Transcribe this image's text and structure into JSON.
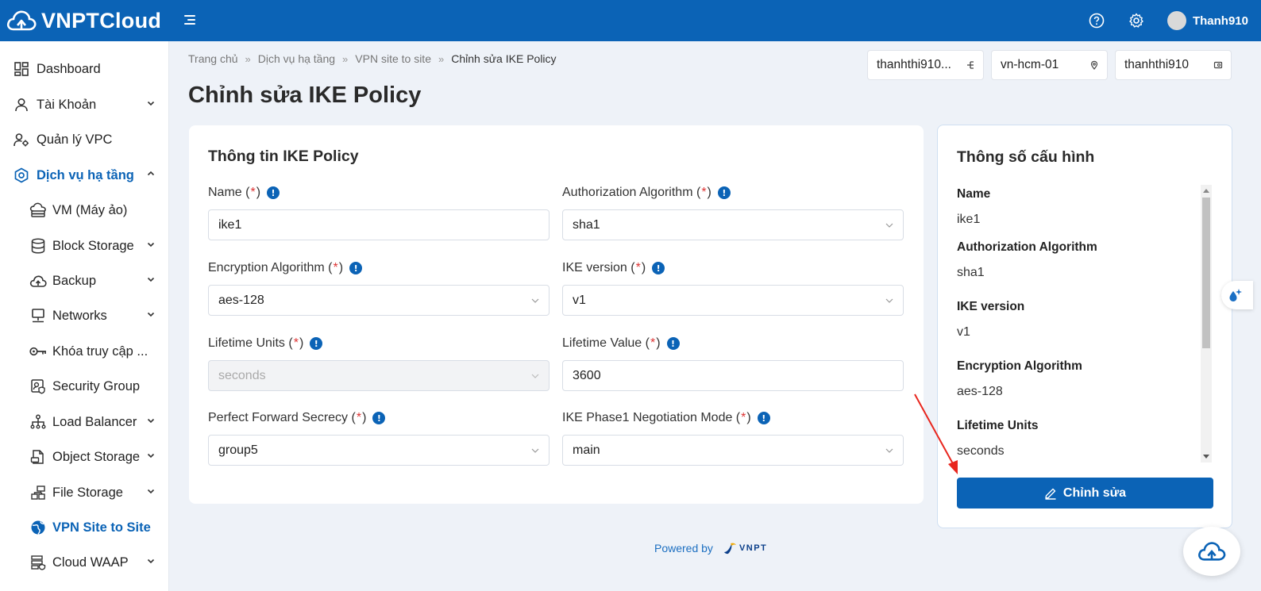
{
  "app": {
    "name": "VNPTCloud",
    "user": "Thanh910"
  },
  "colors": {
    "brand": "#0b63b6",
    "required": "#dd3333",
    "annotation_arrow": "#e8261e"
  },
  "sidebar": {
    "items": [
      {
        "label": "Dashboard",
        "icon": "dashboard-icon",
        "expandable": false
      },
      {
        "label": "Tài Khoản",
        "icon": "user-icon",
        "expandable": true
      },
      {
        "label": "Quản lý VPC",
        "icon": "vpc-manage-icon",
        "expandable": false
      },
      {
        "label": "Dịch vụ hạ tầng",
        "icon": "infrastructure-icon",
        "expandable": true,
        "expanded": true
      },
      {
        "label": "VM (Máy ảo)",
        "icon": "cloud-vm-icon",
        "expandable": false
      },
      {
        "label": "Block Storage",
        "icon": "database-icon",
        "expandable": true
      },
      {
        "label": "Backup",
        "icon": "cloud-upload-icon",
        "expandable": true
      },
      {
        "label": "Networks",
        "icon": "network-icon",
        "expandable": true
      },
      {
        "label": "Khóa truy cập ...",
        "icon": "key-icon",
        "expandable": false
      },
      {
        "label": "Security Group",
        "icon": "security-group-icon",
        "expandable": false
      },
      {
        "label": "Load Balancer",
        "icon": "load-balancer-icon",
        "expandable": true
      },
      {
        "label": "Object Storage",
        "icon": "object-storage-icon",
        "expandable": true
      },
      {
        "label": "File Storage",
        "icon": "file-storage-icon",
        "expandable": true
      },
      {
        "label": "VPN Site to Site",
        "icon": "globe-icon",
        "expandable": false,
        "active": true
      },
      {
        "label": "Cloud WAAP",
        "icon": "waap-icon",
        "expandable": true
      }
    ]
  },
  "breadcrumb": [
    "Trang chủ",
    "Dịch vụ hạ tầng",
    "VPN site to site",
    "Chỉnh sửa IKE Policy"
  ],
  "page": {
    "title": "Chỉnh sửa IKE Policy"
  },
  "selectors": {
    "project": "thanhthi910...",
    "region": "vn-hcm-01",
    "account": "thanhthi910"
  },
  "form": {
    "title": "Thông tin IKE Policy",
    "fields": [
      {
        "label": "Name",
        "value": "ike1",
        "type": "text"
      },
      {
        "label": "Authorization Algorithm",
        "value": "sha1",
        "type": "select"
      },
      {
        "label": "Encryption Algorithm",
        "value": "aes-128",
        "type": "select"
      },
      {
        "label": "IKE version",
        "value": "v1",
        "type": "select"
      },
      {
        "label": "Lifetime Units",
        "value": "seconds",
        "type": "select",
        "disabled": true
      },
      {
        "label": "Lifetime Value",
        "value": "3600",
        "type": "text"
      },
      {
        "label": "Perfect Forward Secrecy",
        "value": "group5",
        "type": "select"
      },
      {
        "label": "IKE Phase1 Negotiation Mode",
        "value": "main",
        "type": "select"
      }
    ],
    "required_mark": "*"
  },
  "side_panel": {
    "title": "Thông số cấu hình",
    "specs": [
      {
        "label": "Name",
        "value": "ike1"
      },
      {
        "label": "Authorization Algorithm",
        "value": "sha1"
      },
      {
        "label": "IKE version",
        "value": "v1"
      },
      {
        "label": "Encryption Algorithm",
        "value": "aes-128"
      },
      {
        "label": "Lifetime Units",
        "value": "seconds"
      }
    ],
    "edit_button": "Chỉnh sửa"
  },
  "footer": {
    "powered_by": "Powered by",
    "brand": "VNPT"
  }
}
